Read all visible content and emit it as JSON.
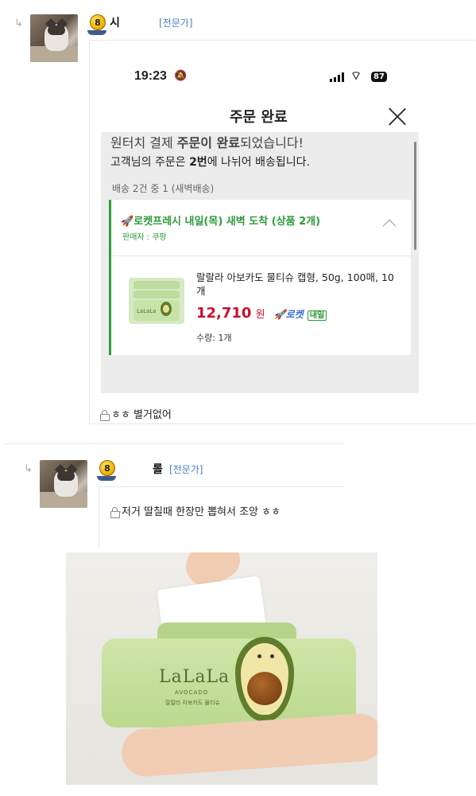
{
  "comment1": {
    "nick": "시",
    "level": "8",
    "expert_label": "[전문가]",
    "text": "ㅎㅎ 별거없어"
  },
  "phone": {
    "time": "19:23",
    "battery": "87",
    "title": "주문 완료",
    "msg1_pre": "원터치 결제 ",
    "msg1_bold": "주문이 완료",
    "msg1_post": "되었습니다!",
    "msg2_pre": "고객님의 주문은 ",
    "msg2_bold": "2번",
    "msg2_post": "에 나뉘어 배송됩니다.",
    "ship_count": "배송 2건 중 1 (새벽배송)",
    "card_title": "로켓프레시  내일(목) 새벽 도착 (상품 2개)",
    "seller": "판매자 : 쿠팡",
    "product_name": "랄랄라 아보카도 물티슈 캡형, 50g, 100매, 10개",
    "price": "12,710",
    "won": "원",
    "rocket_label": "로켓",
    "naeil_label": "내일",
    "qty": "수량: 1개",
    "wipes_brand": "LaLaLa"
  },
  "comment2": {
    "nick": "롤",
    "level": "8",
    "expert_label": "[전문가]",
    "text": "저거 딸칠때 한장만 뽑혀서 조앙 ㅎㅎ"
  },
  "photo": {
    "brand": "LaLaLa",
    "sub_brand": "AVOCADO",
    "pack_caption": "랄랄라 아보카도 물티슈"
  },
  "icons": {
    "reply": "reply-arrow-icon",
    "lock": "lock-icon",
    "close": "close-icon",
    "chevron": "chevron-up-icon",
    "rocket": "rocket-icon"
  }
}
